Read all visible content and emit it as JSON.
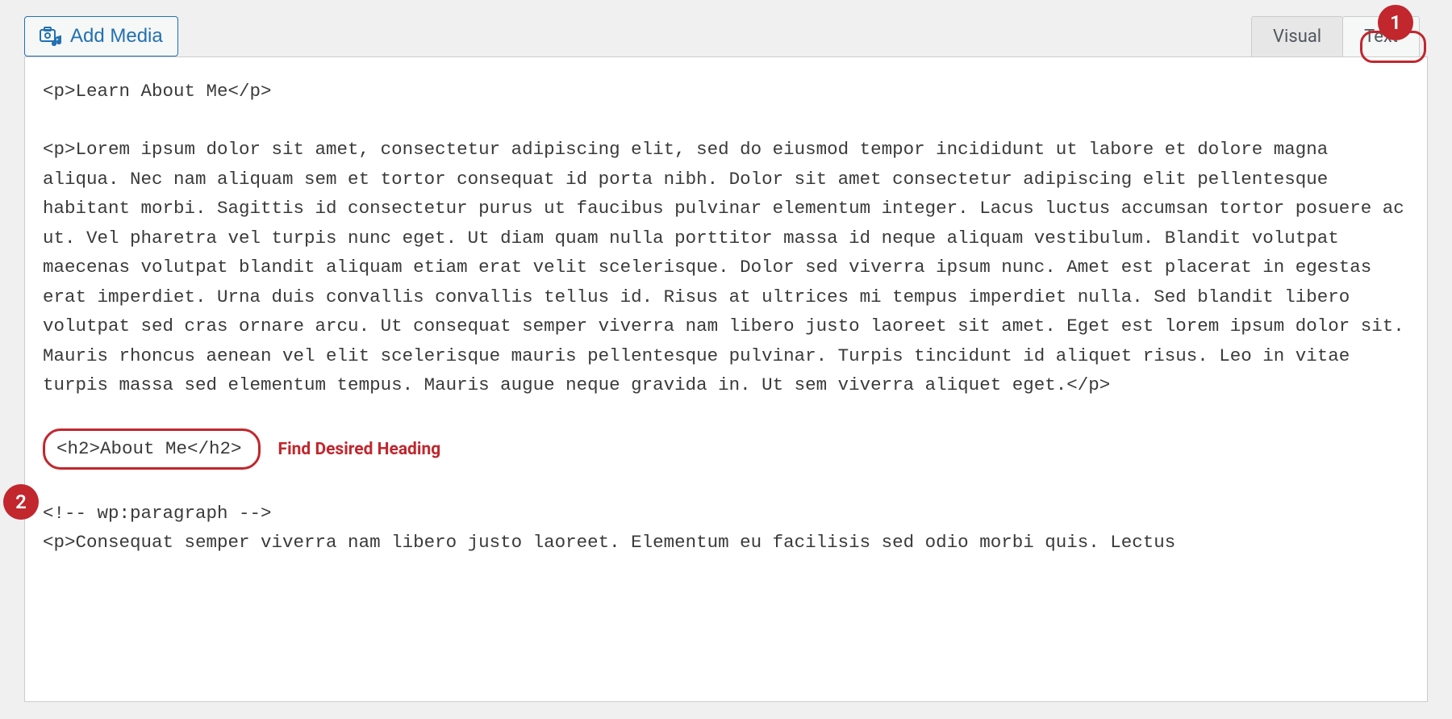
{
  "toolbar": {
    "add_media_label": "Add Media"
  },
  "tabs": {
    "visual_label": "Visual",
    "text_label": "Text"
  },
  "editor": {
    "line1": "<p>Learn About Me</p>",
    "line2": "<p>Lorem ipsum dolor sit amet, consectetur adipiscing elit, sed do eiusmod tempor incididunt ut labore et dolore magna aliqua. Nec nam aliquam sem et tortor consequat id porta nibh. Dolor sit amet consectetur adipiscing elit pellentesque habitant morbi. Sagittis id consectetur purus ut faucibus pulvinar elementum integer. Lacus luctus accumsan tortor posuere ac ut. Vel pharetra vel turpis nunc eget. Ut diam quam nulla porttitor massa id neque aliquam vestibulum. Blandit volutpat maecenas volutpat blandit aliquam etiam erat velit scelerisque. Dolor sed viverra ipsum nunc. Amet est placerat in egestas erat imperdiet. Urna duis convallis convallis tellus id. Risus at ultrices mi tempus imperdiet nulla. Sed blandit libero volutpat sed cras ornare arcu. Ut consequat semper viverra nam libero justo laoreet sit amet. Eget est lorem ipsum dolor sit. Mauris rhoncus aenean vel elit scelerisque mauris pellentesque pulvinar. Turpis tincidunt id aliquet risus. Leo in vitae turpis massa sed elementum tempus. Mauris augue neque gravida in. Ut sem viverra aliquet eget.</p>",
    "line3": "<h2>About Me</h2>",
    "line4": "<!-- wp:paragraph -->",
    "line5": "<p>Consequat semper viverra nam libero justo laoreet. Elementum eu facilisis sed odio morbi quis. Lectus"
  },
  "annotations": {
    "badge1": "1",
    "badge2": "2",
    "heading_note": "Find Desired Heading"
  }
}
